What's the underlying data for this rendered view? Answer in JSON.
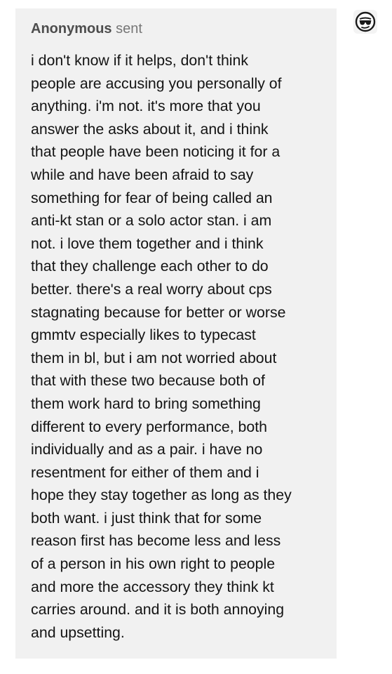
{
  "ask": {
    "sender": "Anonymous",
    "verb": "sent",
    "lines": [
      "i don't know if it helps,  don't think",
      "people are accusing you personally of",
      "anything. i'm not. it's more that you",
      "answer the asks about it, and i think",
      "that people have been noticing it for a",
      "while and have been afraid to say",
      "something for fear of being called an",
      "anti-kt stan or a solo actor stan. i am",
      "not. i love them together and i think",
      "that they challenge each other to do",
      "better. there's a real worry about cps",
      "stagnating because for better or worse",
      "gmmtv especially likes to typecast",
      "them in bl, but i am not worried about",
      "that with these two because both of",
      "them work hard to bring something",
      "different to every performance, both",
      "individually and as a pair. i have no",
      "resentment for either of them and i",
      "hope they stay together as long as they",
      "both want. i just think that for some",
      "reason first has become less and less",
      "of a person in his own right to people",
      "and more the accessory they think kt",
      "carries around. and it is both annoying",
      "and upsetting."
    ]
  },
  "avatar": {
    "icon": "anonymous-sunglasses-icon"
  },
  "colors": {
    "card_background": "#f1f1f1",
    "text": "#141414",
    "header_text": "#4d4d4d"
  }
}
